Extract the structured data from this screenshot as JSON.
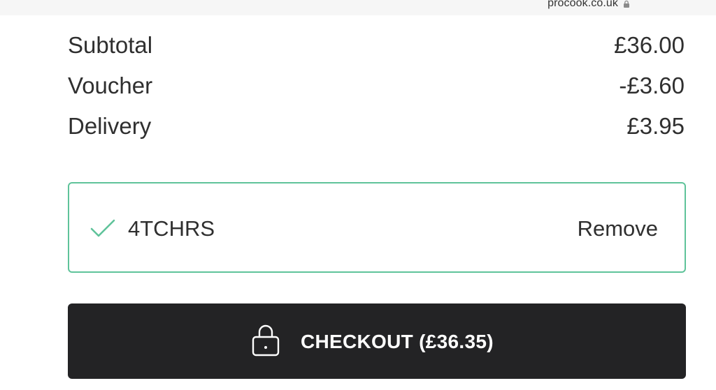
{
  "browser": {
    "url": "procook.co.uk",
    "lock_icon": "lock-icon"
  },
  "summary": {
    "rows": [
      {
        "label": "Subtotal",
        "value": "£36.00"
      },
      {
        "label": "Voucher",
        "value": "-£3.60"
      },
      {
        "label": "Delivery",
        "value": "£3.95"
      }
    ]
  },
  "voucher": {
    "code": "4TCHRS",
    "remove_label": "Remove",
    "status_icon": "checkmark-icon",
    "accent_color": "#5fc39a"
  },
  "checkout": {
    "label": "CHECKOUT (£36.35)",
    "icon": "lock-icon",
    "background_color": "#232325"
  }
}
